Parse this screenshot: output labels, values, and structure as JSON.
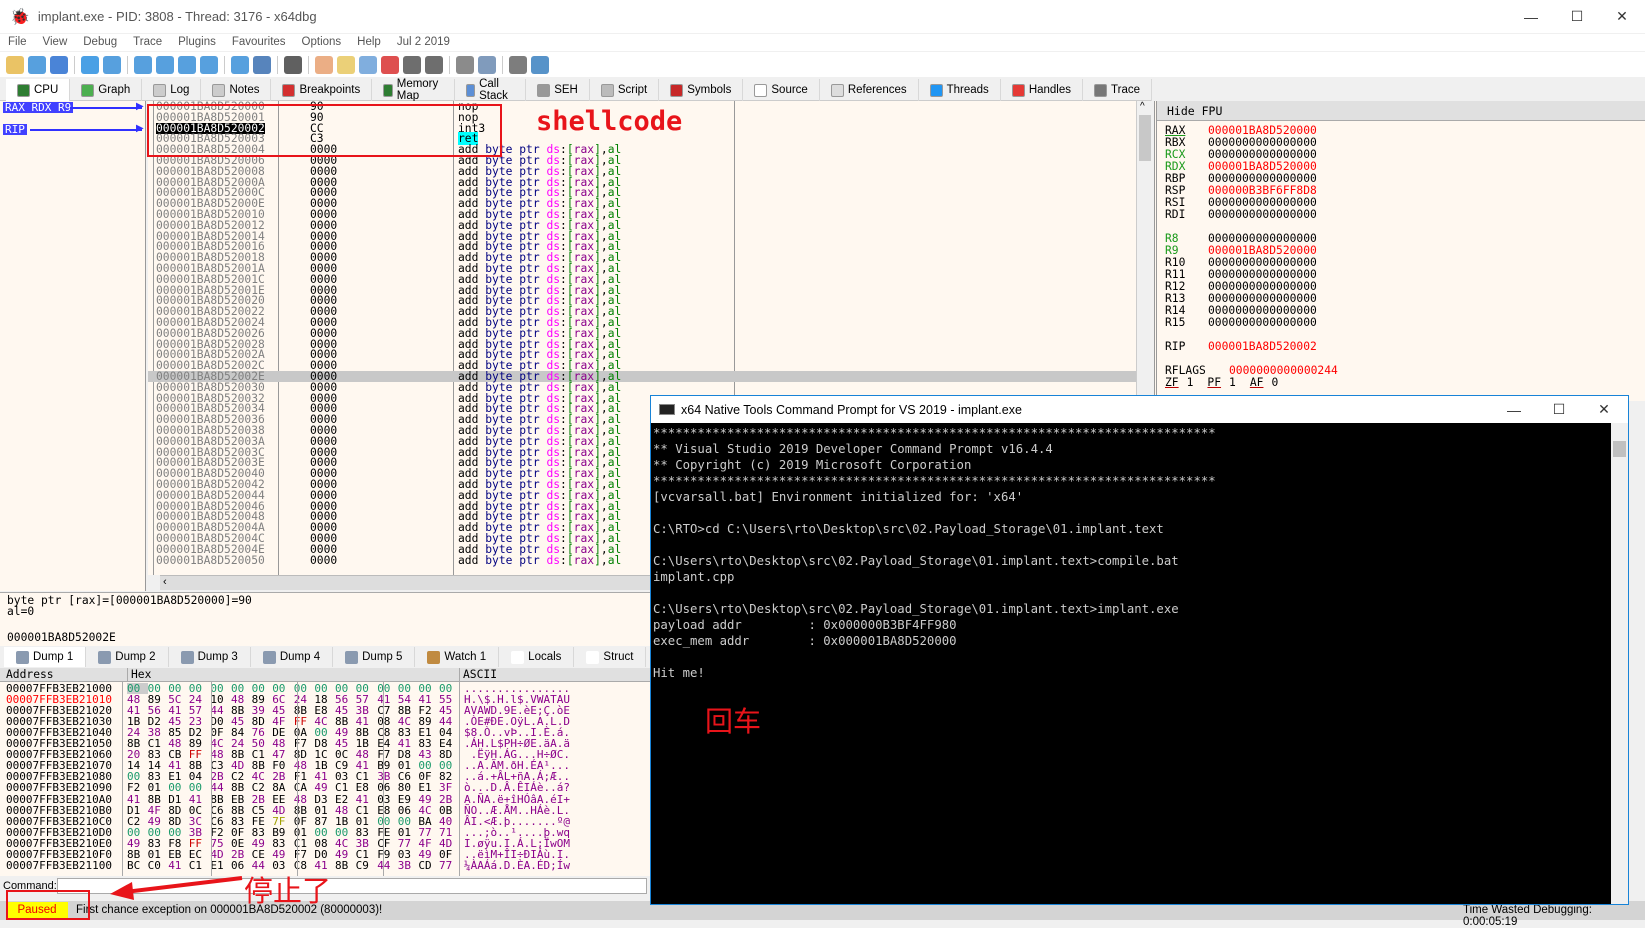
{
  "window": {
    "title": "implant.exe - PID: 3808 - Thread: 3176 - x64dbg",
    "minimize": "—",
    "maximize": "☐",
    "close": "✕"
  },
  "menu": [
    "File",
    "View",
    "Debug",
    "Trace",
    "Plugins",
    "Favourites",
    "Options",
    "Help",
    "Jul 2 2019"
  ],
  "toolbar": [
    "open-icon",
    "restart-icon",
    "stop-icon",
    "run-icon",
    "pause-icon",
    "step-into-icon",
    "step-over-icon",
    "trace-into-icon",
    "trace-over-icon",
    "execute-till-return-icon",
    "run-to-user-code-icon",
    "scylla-icon",
    "patch-icon",
    "comment-icon",
    "label-icon",
    "bookmark-icon",
    "function-icon",
    "hash-icon",
    "font-icon",
    "device-icon",
    "calculator-icon",
    "globe-icon"
  ],
  "tabs": [
    {
      "label": "CPU",
      "icon": "cpu-icon",
      "color": "#2e7d32"
    },
    {
      "label": "Graph",
      "icon": "tree-icon",
      "color": "#4caf50"
    },
    {
      "label": "Log",
      "icon": "log-icon",
      "color": "#ccc"
    },
    {
      "label": "Notes",
      "icon": "notes-icon",
      "color": "#ccc"
    },
    {
      "label": "Breakpoints",
      "icon": "breakpoint-icon",
      "color": "#d32f2f"
    },
    {
      "label": "Memory Map",
      "icon": "memory-icon",
      "color": "#2e7d32"
    },
    {
      "label": "Call Stack",
      "icon": "callstack-icon",
      "color": "#5c8fd6"
    },
    {
      "label": "SEH",
      "icon": "seh-icon",
      "color": "#999"
    },
    {
      "label": "Script",
      "icon": "script-icon",
      "color": "#bbb"
    },
    {
      "label": "Symbols",
      "icon": "symbols-icon",
      "color": "#c62828"
    },
    {
      "label": "Source",
      "icon": "source-icon",
      "color": "#fff"
    },
    {
      "label": "References",
      "icon": "search-icon",
      "color": "#ddd"
    },
    {
      "label": "Threads",
      "icon": "threads-icon",
      "color": "#2196f3"
    },
    {
      "label": "Handles",
      "icon": "handles-icon",
      "color": "#e53935"
    },
    {
      "label": "Trace",
      "icon": "trace-icon",
      "color": "#777"
    }
  ],
  "gutter": {
    "label1": "RAX RDX R9",
    "label2": "RIP"
  },
  "disasm": {
    "selected": "000001BA8D520002",
    "highlighted": "000001BA8D52002E",
    "rows": [
      [
        "000001BA8D520000",
        "90",
        "nop"
      ],
      [
        "000001BA8D520001",
        "90",
        "nop"
      ],
      [
        "000001BA8D520002",
        "CC",
        "int3"
      ],
      [
        "000001BA8D520003",
        "C3",
        "ret"
      ],
      [
        "000001BA8D520004",
        "0000",
        "add byte ptr ds:[rax],al"
      ],
      [
        "000001BA8D520006",
        "0000",
        "add byte ptr ds:[rax],al"
      ],
      [
        "000001BA8D520008",
        "0000",
        "add byte ptr ds:[rax],al"
      ],
      [
        "000001BA8D52000A",
        "0000",
        "add byte ptr ds:[rax],al"
      ],
      [
        "000001BA8D52000C",
        "0000",
        "add byte ptr ds:[rax],al"
      ],
      [
        "000001BA8D52000E",
        "0000",
        "add byte ptr ds:[rax],al"
      ],
      [
        "000001BA8D520010",
        "0000",
        "add byte ptr ds:[rax],al"
      ],
      [
        "000001BA8D520012",
        "0000",
        "add byte ptr ds:[rax],al"
      ],
      [
        "000001BA8D520014",
        "0000",
        "add byte ptr ds:[rax],al"
      ],
      [
        "000001BA8D520016",
        "0000",
        "add byte ptr ds:[rax],al"
      ],
      [
        "000001BA8D520018",
        "0000",
        "add byte ptr ds:[rax],al"
      ],
      [
        "000001BA8D52001A",
        "0000",
        "add byte ptr ds:[rax],al"
      ],
      [
        "000001BA8D52001C",
        "0000",
        "add byte ptr ds:[rax],al"
      ],
      [
        "000001BA8D52001E",
        "0000",
        "add byte ptr ds:[rax],al"
      ],
      [
        "000001BA8D520020",
        "0000",
        "add byte ptr ds:[rax],al"
      ],
      [
        "000001BA8D520022",
        "0000",
        "add byte ptr ds:[rax],al"
      ],
      [
        "000001BA8D520024",
        "0000",
        "add byte ptr ds:[rax],al"
      ],
      [
        "000001BA8D520026",
        "0000",
        "add byte ptr ds:[rax],al"
      ],
      [
        "000001BA8D520028",
        "0000",
        "add byte ptr ds:[rax],al"
      ],
      [
        "000001BA8D52002A",
        "0000",
        "add byte ptr ds:[rax],al"
      ],
      [
        "000001BA8D52002C",
        "0000",
        "add byte ptr ds:[rax],al"
      ],
      [
        "000001BA8D52002E",
        "0000",
        "add byte ptr ds:[rax],al"
      ],
      [
        "000001BA8D520030",
        "0000",
        "add byte ptr ds:[rax],al"
      ],
      [
        "000001BA8D520032",
        "0000",
        "add byte ptr ds:[rax],al"
      ],
      [
        "000001BA8D520034",
        "0000",
        "add byte ptr ds:[rax],al"
      ],
      [
        "000001BA8D520036",
        "0000",
        "add byte ptr ds:[rax],al"
      ],
      [
        "000001BA8D520038",
        "0000",
        "add byte ptr ds:[rax],al"
      ],
      [
        "000001BA8D52003A",
        "0000",
        "add byte ptr ds:[rax],al"
      ],
      [
        "000001BA8D52003C",
        "0000",
        "add byte ptr ds:[rax],al"
      ],
      [
        "000001BA8D52003E",
        "0000",
        "add byte ptr ds:[rax],al"
      ],
      [
        "000001BA8D520040",
        "0000",
        "add byte ptr ds:[rax],al"
      ],
      [
        "000001BA8D520042",
        "0000",
        "add byte ptr ds:[rax],al"
      ],
      [
        "000001BA8D520044",
        "0000",
        "add byte ptr ds:[rax],al"
      ],
      [
        "000001BA8D520046",
        "0000",
        "add byte ptr ds:[rax],al"
      ],
      [
        "000001BA8D520048",
        "0000",
        "add byte ptr ds:[rax],al"
      ],
      [
        "000001BA8D52004A",
        "0000",
        "add byte ptr ds:[rax],al"
      ],
      [
        "000001BA8D52004C",
        "0000",
        "add byte ptr ds:[rax],al"
      ],
      [
        "000001BA8D52004E",
        "0000",
        "add byte ptr ds:[rax],al"
      ],
      [
        "000001BA8D520050",
        "0000",
        "add byte ptr ds:[rax],al"
      ]
    ]
  },
  "registers": {
    "header": "Hide FPU",
    "groups": [
      [
        [
          "RAX",
          "000001BA8D520000",
          "changed"
        ],
        [
          "RBX",
          "0000000000000000",
          ""
        ],
        [
          "RCX",
          "0000000000000000",
          "name-green"
        ],
        [
          "RDX",
          "000001BA8D520000",
          "changed"
        ],
        [
          "RBP",
          "0000000000000000",
          ""
        ],
        [
          "RSP",
          "000000B3BF6FF8D8",
          "changed"
        ],
        [
          "RSI",
          "0000000000000000",
          ""
        ],
        [
          "RDI",
          "0000000000000000",
          ""
        ]
      ],
      [
        [
          "R8",
          "0000000000000000",
          "name-green"
        ],
        [
          "R9",
          "000001BA8D520000",
          "changed"
        ],
        [
          "R10",
          "0000000000000000",
          ""
        ],
        [
          "R11",
          "0000000000000000",
          ""
        ],
        [
          "R12",
          "0000000000000000",
          ""
        ],
        [
          "R13",
          "0000000000000000",
          ""
        ],
        [
          "R14",
          "0000000000000000",
          ""
        ],
        [
          "R15",
          "0000000000000000",
          ""
        ]
      ],
      [
        [
          "RIP",
          "000001BA8D520002",
          "changed"
        ]
      ],
      [
        [
          "RFLAGS",
          "0000000000000244",
          "changed"
        ]
      ]
    ],
    "flags": [
      [
        "ZF",
        "1"
      ],
      [
        "PF",
        "1"
      ],
      [
        "AF",
        "0"
      ]
    ]
  },
  "info": {
    "line1": "byte ptr [rax]=[000001BA8D520000]=90",
    "line2": "al=0",
    "line3": "000001BA8D52002E"
  },
  "dump_tabs": [
    {
      "label": "Dump 1",
      "icon": "dump-icon"
    },
    {
      "label": "Dump 2",
      "icon": "dump-icon"
    },
    {
      "label": "Dump 3",
      "icon": "dump-icon"
    },
    {
      "label": "Dump 4",
      "icon": "dump-icon"
    },
    {
      "label": "Dump 5",
      "icon": "dump-icon"
    },
    {
      "label": "Watch 1",
      "icon": "watch-icon"
    },
    {
      "label": "Locals",
      "icon": "locals-icon"
    },
    {
      "label": "Struct",
      "icon": "struct-icon"
    }
  ],
  "dump": {
    "headers": {
      "address": "Address",
      "hex": "Hex",
      "ascii": "ASCII"
    },
    "rows": [
      [
        "00007FFB3EB21000",
        "00 00 00 00 00 00 00 00 00 00 00 00 00 00 00 00",
        "................"
      ],
      [
        "00007FFB3EB21010",
        "48 89 5C 24 10 48 89 6C 24 18 56 57 41 54 41 55",
        "H.\\$.H.l$.VWATAU"
      ],
      [
        "00007FFB3EB21020",
        "41 56 41 57 44 8B 39 45 8B E8 45 3B C7 8B F2 45",
        "AVAWD.9E.èE;Ç.òE"
      ],
      [
        "00007FFB3EB21030",
        "1B D2 45 23 D0 45 8D 4F FF 4C 8B 41 08 4C 89 44",
        ".ÒE#ÐE.OÿL.A.L.D"
      ],
      [
        "00007FFB3EB21040",
        "24 38 85 D2 0F 84 76 DE 0A 00 49 8B C8 83 E1 04",
        "$8.Ò..vÞ..I.È.á."
      ],
      [
        "00007FFB3EB21050",
        "8B C1 48 89 4C 24 50 48 F7 D8 45 1B E4 41 83 E4",
        ".ÁH.L$PH÷ØE.äA.ä"
      ],
      [
        "00007FFB3EB21060",
        "20 83 CB FF 48 8B C1 47 8D 1C 0C 48 F7 D8 43 8D",
        " .ËÿH.ÁG...H÷ØC."
      ],
      [
        "00007FFB3EB21070",
        "14 14 41 8B C3 4D 8B F0 48 1B C9 41 B9 01 00 00",
        "..A.ÃM.ðH.ÉA¹..."
      ],
      [
        "00007FFB3EB21080",
        "00 83 E1 04 2B C2 4C 2B F1 41 03 C1 3B C6 0F 82",
        "..á.+ÂL+ñA.Á;Æ.."
      ],
      [
        "00007FFB3EB21090",
        "F2 01 00 00 44 8B C2 8A CA 49 C1 E8 06 80 E1 3F",
        "ò...D.Â.ÊIÁè..á?"
      ],
      [
        "00007FFB3EB210A0",
        "41 8B D1 41 8B EB 2B EE 48 D3 E2 41 03 E9 49 2B",
        "A.ÑA.ë+îHÓâA.éI+"
      ],
      [
        "00007FFB3EB210B0",
        "D1 4F 8D 0C C6 8B C5 4D 8B 01 48 C1 E8 06 4C 0B",
        "ÑO..Æ.ÅM..HÁè.L."
      ],
      [
        "00007FFB3EB210C0",
        "C2 49 8D 3C C6 83 FE 7F 0F 87 1B 01 00 00 BA 40",
        "ÂI.<Æ.þ.......º@"
      ],
      [
        "00007FFB3EB210D0",
        "00 00 00 3B F2 0F 83 B9 01 00 00 83 FE 01 77 71",
        "...;ò..¹....þ.wq"
      ],
      [
        "00007FFB3EB210E0",
        "49 83 F8 FF 75 0E 49 83 C1 08 4C 3B CF 77 4F 4D",
        "I.øÿu.I.Á.L;ÏwOM"
      ],
      [
        "00007FFB3EB210F0",
        "8B 01 EB EC 4D 2B CE 49 F7 D0 49 C1 F9 03 49 0F",
        "..ëìM+ÎI÷ÐIÁù.I."
      ],
      [
        "00007FFB3EB21100",
        "BC C0 41 C1 E1 06 44 03 C8 41 8B C9 44 3B CD 77",
        "¼ÀAÁá.D.ÈA.ÉD;Íw"
      ]
    ],
    "red_address": "00007FFB3EB21010"
  },
  "command": {
    "label": "Command:",
    "value": ""
  },
  "status": {
    "state": "Paused",
    "message": "First chance exception on 000001BA8D520002 (80000003)!",
    "time_wasted": "Time Wasted Debugging: 0:00:05:19"
  },
  "console": {
    "title": "x64 Native Tools Command Prompt for VS 2019 - implant.exe",
    "minimize": "—",
    "maximize": "☐",
    "close": "✕",
    "lines": [
      "****************************************************************************",
      "** Visual Studio 2019 Developer Command Prompt v16.4.4",
      "** Copyright (c) 2019 Microsoft Corporation",
      "****************************************************************************",
      "[vcvarsall.bat] Environment initialized for: 'x64'",
      "",
      "C:\\RTO>cd C:\\Users\\rto\\Desktop\\src\\02.Payload_Storage\\01.implant.text",
      "",
      "C:\\Users\\rto\\Desktop\\src\\02.Payload_Storage\\01.implant.text>compile.bat",
      "implant.cpp",
      "",
      "C:\\Users\\rto\\Desktop\\src\\02.Payload_Storage\\01.implant.text>implant.exe",
      "payload addr         : 0x000000B3BF4FF980",
      "exec_mem addr        : 0x000001BA8D520000",
      "",
      "Hit me!"
    ]
  },
  "annotations": {
    "shellcode": "shellcode",
    "enter": "回车",
    "stopped": "停止了",
    "color": "#e8141a"
  },
  "colors": {
    "pane_bg": "#fff8f0",
    "changed_register": "#ff0000",
    "selection": "#000000",
    "ret_highlight": "#00ffff",
    "paused_bg": "#ffff00"
  }
}
